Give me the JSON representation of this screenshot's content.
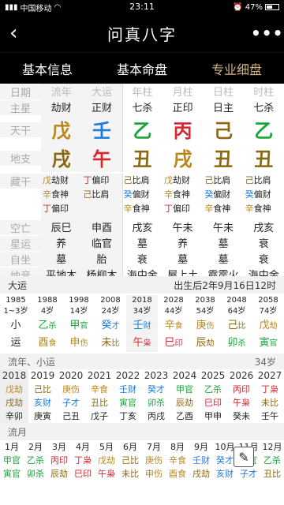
{
  "status": {
    "carrier": "中国移动",
    "time": "23:11",
    "battery": "47%"
  },
  "header": {
    "title": "问真八字",
    "back_icon": "‹",
    "more_icon": "•••"
  },
  "tabs": [
    {
      "label": "基本信息"
    },
    {
      "label": "基本命盘"
    },
    {
      "label": "专业细盘",
      "active": true
    }
  ],
  "pillars": {
    "row_labels": [
      "日期",
      "主星",
      "天干",
      "地支",
      "藏干",
      "空亡",
      "星运",
      "自坐",
      "纳音"
    ],
    "headers": [
      "流年",
      "大运",
      "年柱",
      "月柱",
      "日柱",
      "时柱"
    ],
    "zhuxing": [
      "劫财",
      "正财",
      "七杀",
      "正印",
      "日主",
      "七杀"
    ],
    "tiangan": [
      {
        "c": "戊",
        "col": "#b9871b"
      },
      {
        "c": "壬",
        "col": "#1e7be0"
      },
      {
        "c": "乙",
        "col": "#1aa53a"
      },
      {
        "c": "丙",
        "col": "#d7282f"
      },
      {
        "c": "己",
        "col": "#8b6914"
      },
      {
        "c": "乙",
        "col": "#1aa53a"
      }
    ],
    "dizhi": [
      {
        "c": "戌",
        "col": "#8b6914"
      },
      {
        "c": "午",
        "col": "#d7282f"
      },
      {
        "c": "丑",
        "col": "#8b6914"
      },
      {
        "c": "戌",
        "col": "#b9871b"
      },
      {
        "c": "丑",
        "col": "#8b6914"
      },
      {
        "c": "丑",
        "col": "#8b6914"
      }
    ],
    "canggan": [
      [
        {
          "g": "戊",
          "s": "劫财",
          "col": "#b9871b"
        },
        {
          "g": "辛",
          "s": "食神",
          "col": "#b9871b"
        },
        {
          "g": "丁",
          "s": "偏印",
          "col": "#d7282f"
        }
      ],
      [
        {
          "g": "丁",
          "s": "偏印",
          "col": "#d7282f"
        },
        {
          "g": "己",
          "s": "比肩",
          "col": "#8b6914"
        }
      ],
      [
        {
          "g": "己",
          "s": "比肩",
          "col": "#8b6914"
        },
        {
          "g": "癸",
          "s": "偏财",
          "col": "#1e7be0"
        },
        {
          "g": "辛",
          "s": "食神",
          "col": "#b9871b"
        }
      ],
      [
        {
          "g": "戊",
          "s": "劫财",
          "col": "#b9871b"
        },
        {
          "g": "辛",
          "s": "食神",
          "col": "#b9871b"
        },
        {
          "g": "丁",
          "s": "偏印",
          "col": "#d7282f"
        }
      ],
      [
        {
          "g": "己",
          "s": "比肩",
          "col": "#8b6914"
        },
        {
          "g": "癸",
          "s": "偏财",
          "col": "#1e7be0"
        },
        {
          "g": "辛",
          "s": "食神",
          "col": "#b9871b"
        }
      ],
      [
        {
          "g": "己",
          "s": "比肩",
          "col": "#8b6914"
        },
        {
          "g": "癸",
          "s": "偏财",
          "col": "#1e7be0"
        },
        {
          "g": "辛",
          "s": "食神",
          "col": "#b9871b"
        }
      ]
    ],
    "kongwang": [
      "辰巳",
      "申酉",
      "戌亥",
      "午未",
      "午未",
      "戌亥"
    ],
    "xingyun": [
      "养",
      "临官",
      "墓",
      "养",
      "墓",
      "衰"
    ],
    "zizuo": [
      "墓",
      "胎",
      "衰",
      "墓",
      "墓",
      "衰"
    ],
    "nayin": [
      "平地木",
      "杨柳木",
      "海中金",
      "屋上土",
      "霹雳火",
      "海中金"
    ]
  },
  "dayun": {
    "title": "大运",
    "birth_info": "出生后2年9月16日12时",
    "cols": [
      {
        "year": "1985",
        "age": "1~3岁",
        "g": "小",
        "gs": "",
        "z": "运",
        "zs": "",
        "gc": "#333",
        "zc": "#333"
      },
      {
        "year": "1988",
        "age": "4岁",
        "g": "乙",
        "gs": "杀",
        "z": "酉",
        "zs": "食",
        "gc": "#1aa53a",
        "zc": "#b9871b"
      },
      {
        "year": "1998",
        "age": "14岁",
        "g": "甲",
        "gs": "官",
        "z": "申",
        "zs": "伤",
        "gc": "#1aa53a",
        "zc": "#b9871b"
      },
      {
        "year": "2008",
        "age": "24岁",
        "g": "癸",
        "gs": "才",
        "z": "未",
        "zs": "比",
        "gc": "#1e7be0",
        "zc": "#8b6914"
      },
      {
        "year": "2018",
        "age": "34岁",
        "g": "壬",
        "gs": "财",
        "z": "午",
        "zs": "枭",
        "gc": "#1e7be0",
        "zc": "#d7282f",
        "sel": true
      },
      {
        "year": "2028",
        "age": "44岁",
        "g": "辛",
        "gs": "食",
        "z": "巳",
        "zs": "印",
        "gc": "#b9871b",
        "zc": "#d7282f"
      },
      {
        "year": "2038",
        "age": "54岁",
        "g": "庚",
        "gs": "伤",
        "z": "辰",
        "zs": "劫",
        "gc": "#b9871b",
        "zc": "#8b6914"
      },
      {
        "year": "2048",
        "age": "64岁",
        "g": "己",
        "gs": "比",
        "z": "卯",
        "zs": "杀",
        "gc": "#8b6914",
        "zc": "#1aa53a"
      },
      {
        "year": "2058",
        "age": "74岁",
        "g": "戊",
        "gs": "劫",
        "z": "寅",
        "zs": "官",
        "gc": "#b9871b",
        "zc": "#1aa53a"
      }
    ]
  },
  "liunian": {
    "title": "流年、小运",
    "age": "34岁",
    "cols": [
      {
        "yr": "2018",
        "a": "戊劫",
        "b": "戌劫",
        "c": "辛卯",
        "sel": true
      },
      {
        "yr": "2019",
        "a": "己比",
        "b": "亥财",
        "c": "庚寅"
      },
      {
        "yr": "2020",
        "a": "庚伤",
        "b": "子才",
        "c": "己丑"
      },
      {
        "yr": "2021",
        "a": "辛食",
        "b": "丑比",
        "c": "戊子"
      },
      {
        "yr": "2022",
        "a": "壬财",
        "b": "寅官",
        "c": "丁亥"
      },
      {
        "yr": "2023",
        "a": "癸才",
        "b": "卯杀",
        "c": "丙戌"
      },
      {
        "yr": "2024",
        "a": "甲官",
        "b": "辰劫",
        "c": "乙酉"
      },
      {
        "yr": "2025",
        "a": "乙杀",
        "b": "巳印",
        "c": "甲申"
      },
      {
        "yr": "2026",
        "a": "丙印",
        "b": "午枭",
        "c": "癸未"
      },
      {
        "yr": "2027",
        "a": "丁枭",
        "b": "未比",
        "c": "壬午"
      }
    ]
  },
  "liuyue": {
    "title": "流月",
    "cols": [
      {
        "m": "1月",
        "a": "甲官",
        "b": "寅官"
      },
      {
        "m": "2月",
        "a": "乙杀",
        "b": "卯杀"
      },
      {
        "m": "3月",
        "a": "丙印",
        "b": "辰劫"
      },
      {
        "m": "4月",
        "a": "丁枭",
        "b": "巳印"
      },
      {
        "m": "5月",
        "a": "戊劫",
        "b": "午枭"
      },
      {
        "m": "6月",
        "a": "己比",
        "b": "未比"
      },
      {
        "m": "7月",
        "a": "庚伤",
        "b": "申伤"
      },
      {
        "m": "8月",
        "a": "辛食",
        "b": "酉食"
      },
      {
        "m": "9月",
        "a": "壬财",
        "b": "戌劫"
      },
      {
        "m": "10月",
        "a": "癸才",
        "b": "亥财"
      },
      {
        "m": "11月",
        "a": "甲官",
        "b": "子才"
      },
      {
        "m": "12月",
        "a": "乙杀",
        "b": "丑比"
      }
    ]
  },
  "fab_icon": "✎"
}
